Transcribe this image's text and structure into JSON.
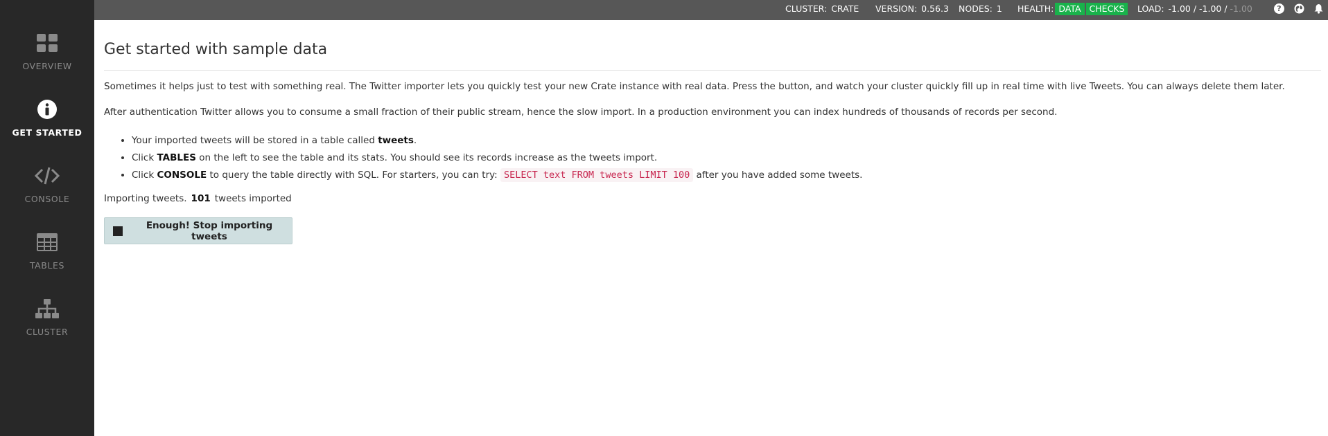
{
  "sidebar": {
    "items": [
      {
        "label": "OVERVIEW",
        "icon": "dashboard-icon"
      },
      {
        "label": "GET STARTED",
        "icon": "info-icon"
      },
      {
        "label": "CONSOLE",
        "icon": "code-icon"
      },
      {
        "label": "TABLES",
        "icon": "table-icon"
      },
      {
        "label": "CLUSTER",
        "icon": "sitemap-icon"
      }
    ]
  },
  "topbar": {
    "cluster_label": "CLUSTER:",
    "cluster_value": "CRATE",
    "version_label": "VERSION:",
    "version_value": "0.56.3",
    "nodes_label": "NODES:",
    "nodes_value": "1",
    "health_label": "HEALTH:",
    "health_data": "DATA",
    "health_checks": "CHECKS",
    "load_label": "LOAD:",
    "load_value": "-1.00 / -1.00 /",
    "load_value_dim": "-1.00",
    "health_color": "#19b24b",
    "icons": [
      "help-icon",
      "globe-icon",
      "bell-icon"
    ]
  },
  "main": {
    "title": "Get started with sample data",
    "para1": "Sometimes it helps just to test with something real. The Twitter importer lets you quickly test your new Crate instance with real data. Press the button, and watch your cluster quickly fill up in real time with live Tweets. You can always delete them later.",
    "para2": "After authentication Twitter allows you to consume a small fraction of their public stream, hence the slow import. In a production environment you can index hundreds of thousands of records per second.",
    "bullet1_pre": "Your imported tweets will be stored in a table called ",
    "bullet1_bold": "tweets",
    "bullet1_post": ".",
    "bullet2_pre": "Click ",
    "bullet2_bold": "TABLES",
    "bullet2_post": " on the left to see the table and its stats. You should see its records increase as the tweets import.",
    "bullet3_pre": "Click ",
    "bullet3_bold": "CONSOLE",
    "bullet3_mid": " to query the table directly with SQL. For starters, you can try: ",
    "bullet3_code": "SELECT text FROM tweets LIMIT 100",
    "bullet3_post": " after you have added some tweets.",
    "import_prefix": "Importing tweets.",
    "import_count": "101",
    "import_suffix": "tweets imported",
    "stop_button": "Enough! Stop importing tweets"
  }
}
